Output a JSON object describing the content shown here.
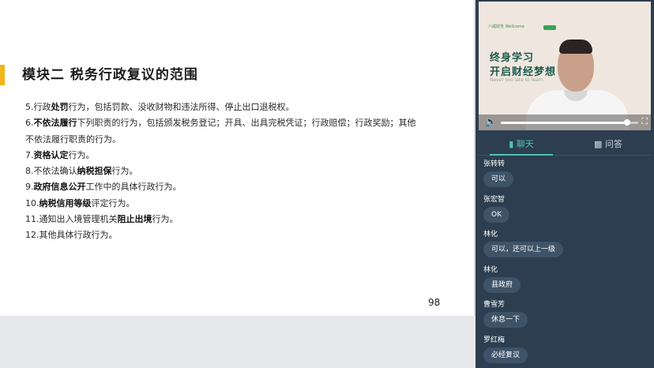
{
  "slide": {
    "title": "模块二  税务行政复议的范围",
    "lines": [
      [
        {
          "t": "5.行政"
        },
        {
          "t": "处罚",
          "b": true
        },
        {
          "t": "行为，包括罚款、没收财物和违法所得、停止出口退税权。"
        }
      ],
      [
        {
          "t": "6."
        },
        {
          "t": "不依法履行",
          "b": true
        },
        {
          "t": "下列职责的行为，包括颁发税务登记；开具、出具完税凭证；行政赔偿；行政奖励；其他"
        }
      ],
      [
        {
          "t": "不依法履行职责的行为。"
        }
      ],
      [
        {
          "t": "7."
        },
        {
          "t": "资格认定",
          "b": true
        },
        {
          "t": "行为。"
        }
      ],
      [
        {
          "t": "8.不依法确认"
        },
        {
          "t": "纳税担保",
          "b": true
        },
        {
          "t": "行为。"
        }
      ],
      [
        {
          "t": "9."
        },
        {
          "t": "政府信息公开",
          "b": true
        },
        {
          "t": "工作中的具体行政行为。"
        }
      ],
      [
        {
          "t": "10."
        },
        {
          "t": "纳税信用等级",
          "b": true
        },
        {
          "t": "评定行为。"
        }
      ],
      [
        {
          "t": "11.通知出入境管理机关"
        },
        {
          "t": "阻止出境",
          "b": true
        },
        {
          "t": "行为。"
        }
      ],
      [
        {
          "t": "12.其他具体行政行为。"
        }
      ]
    ],
    "page_number": "98"
  },
  "video": {
    "logo_text": "八戒财务  Wellcome",
    "slogan_line1": "终身学习",
    "slogan_line2": "开启财经梦想",
    "slogan_line3": "Never too late to learn",
    "volume_level": 0.92
  },
  "tabs": {
    "chat": "聊天",
    "qa": "问答"
  },
  "messages": [
    {
      "name": "张转转",
      "text": "可以"
    },
    {
      "name": "张宏智",
      "text": "OK"
    },
    {
      "name": "林化",
      "text": "可以，还可以上一级"
    },
    {
      "name": "林化",
      "text": "县政府"
    },
    {
      "name": "曹雪芳",
      "text": "休息一下"
    },
    {
      "name": "罗红梅",
      "text": "必经复议"
    }
  ],
  "colors": {
    "accent": "#f2b51b",
    "tab_active": "#4fc3b4",
    "sidebar": "#2c3e50"
  }
}
